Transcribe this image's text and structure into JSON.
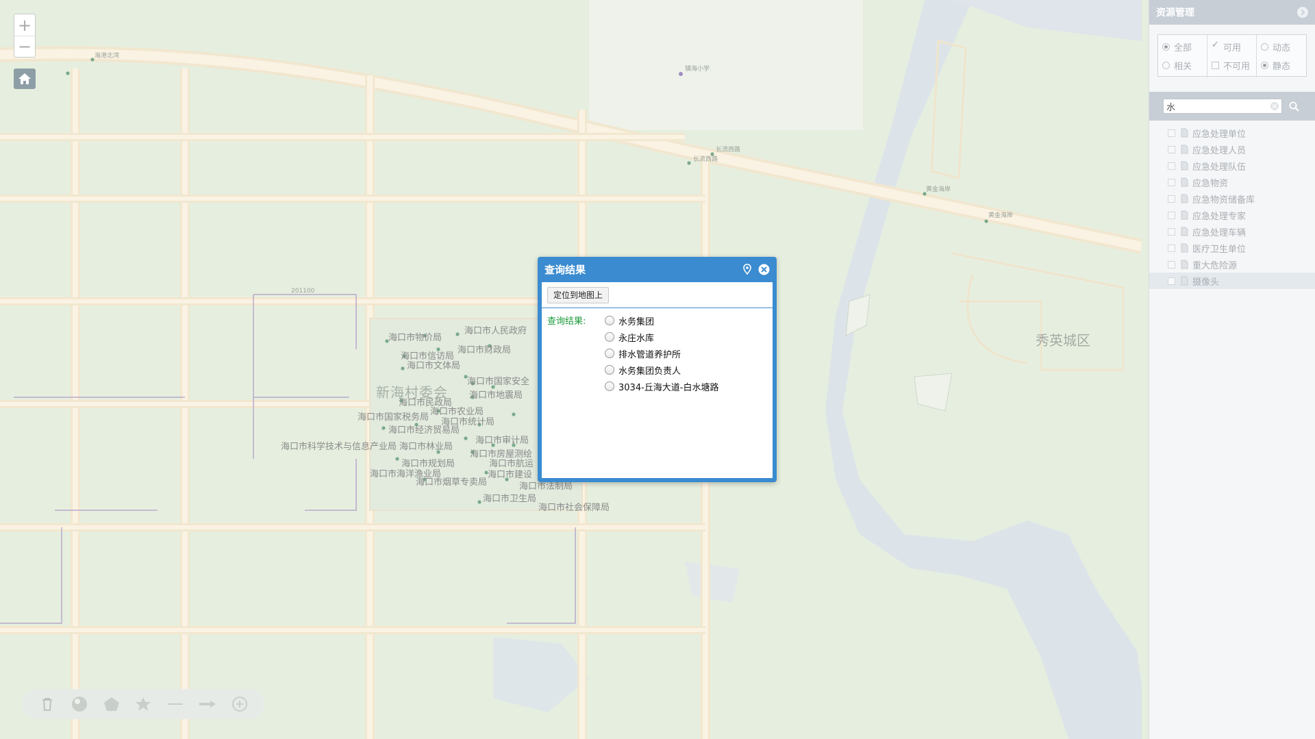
{
  "map": {
    "zoom_in": "+",
    "zoom_out": "−",
    "labels": {
      "district": "秀英城区",
      "village": "新海村委会",
      "school": "镇海小学",
      "bureau_price": "海口市物价局",
      "gov": "海口市人民政府",
      "finance": "海口市财政局",
      "petition": "海口市信访局",
      "culture": "海口市文体局",
      "safety": "海口市国家安全",
      "geo": "海口市地震局",
      "civil": "海口市民政局",
      "agri": "海口市农业局",
      "tax": "海口市国家税务局",
      "stats": "海口市统计局",
      "economy": "海口市经济贸易局",
      "tech": "海口市科学技术与信息产业局",
      "forestry": "海口市林业局",
      "audit": "海口市审计局",
      "housing": "海口市房屋测绘",
      "planning": "海口市规划局",
      "aviation": "海口市航运",
      "ocean": "海口市海洋渔业局",
      "build": "海口市建设",
      "tobacco": "海口市烟草专卖局",
      "legal": "海口市法制局",
      "health": "海口市卫生局",
      "social": "海口市社会保障局",
      "road1": "长流西路",
      "road2": "长流西路",
      "road3": "黄金海岸",
      "road4": "黄金海岸",
      "r1": "海港北湾",
      "r2": "201100"
    }
  },
  "colors": {
    "accent": "#3a8bd0",
    "panel_header": "#c7ced6",
    "result_label": "#1a9a3a"
  },
  "dialog": {
    "title": "查询结果",
    "locate_button": "定位到地图上",
    "result_label": "查询结果:",
    "results": [
      "水务集团",
      "永庄水库",
      "排水管道养护所",
      "水务集团负责人",
      "3034-丘海大道-白水塘路"
    ]
  },
  "panel": {
    "title": "资源管理",
    "filters": {
      "all": "全部",
      "related": "相关",
      "available": "可用",
      "unavailable": "不可用",
      "dynamic": "动态",
      "static": "静态"
    },
    "search": {
      "value": "水"
    },
    "tree": [
      "应急处理单位",
      "应急处理人员",
      "应急处理队伍",
      "应急物资",
      "应急物资储备库",
      "应急处理专家",
      "应急处理车辆",
      "医疗卫生单位",
      "重大危险源",
      "摄像头"
    ]
  },
  "toolbar": {
    "tools": [
      "clear-icon",
      "globe-icon",
      "polygon-icon",
      "star-icon",
      "line-icon",
      "arrow-icon",
      "plus-circle-icon"
    ]
  }
}
